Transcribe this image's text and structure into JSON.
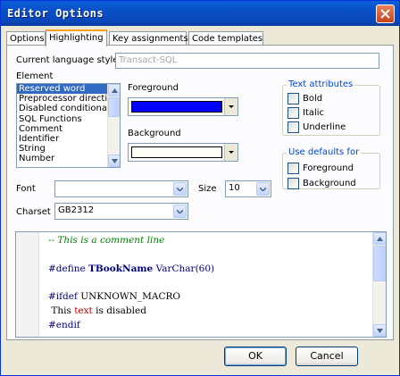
{
  "window": {
    "title": "Editor Options"
  },
  "tabs": [
    {
      "label": "Options"
    },
    {
      "label": "Highlighting"
    },
    {
      "label": "Key assignments"
    },
    {
      "label": "Code templates"
    }
  ],
  "highlighting": {
    "language_style_label": "Current language style",
    "language_style_value": "Transact-SQL",
    "element_label": "Element",
    "elements": [
      "Reserved word",
      "Preprocessor directive",
      "Disabled conditional",
      "SQL Functions",
      "Comment",
      "Identifier",
      "String",
      "Number"
    ],
    "selected_element": "Reserved word",
    "foreground_label": "Foreground",
    "foreground_color": "#0000ff",
    "background_label": "Background",
    "background_color": "#fffff8",
    "text_attributes": {
      "title": "Text attributes",
      "bold": "Bold",
      "italic": "Italic",
      "underline": "Underline"
    },
    "use_defaults": {
      "title": "Use defaults for",
      "foreground": "Foreground",
      "background": "Background"
    },
    "font_label": "Font",
    "font_value": "",
    "size_label": "Size",
    "size_value": "10",
    "charset_label": "Charset",
    "charset_value": "GB2312"
  },
  "preview": {
    "comment": "-- This is a comment line",
    "define_kw": "#define",
    "define_name": "TBookName",
    "define_type": "VarChar",
    "define_num": "(60)",
    "ifdef_kw": "#ifdef",
    "ifdef_name": "UNKNOWN_MACRO",
    "disabled_a": " This ",
    "disabled_b": "text",
    "disabled_c": " is disabled",
    "endif_kw": "#endif"
  },
  "buttons": {
    "ok": "OK",
    "cancel": "Cancel"
  }
}
